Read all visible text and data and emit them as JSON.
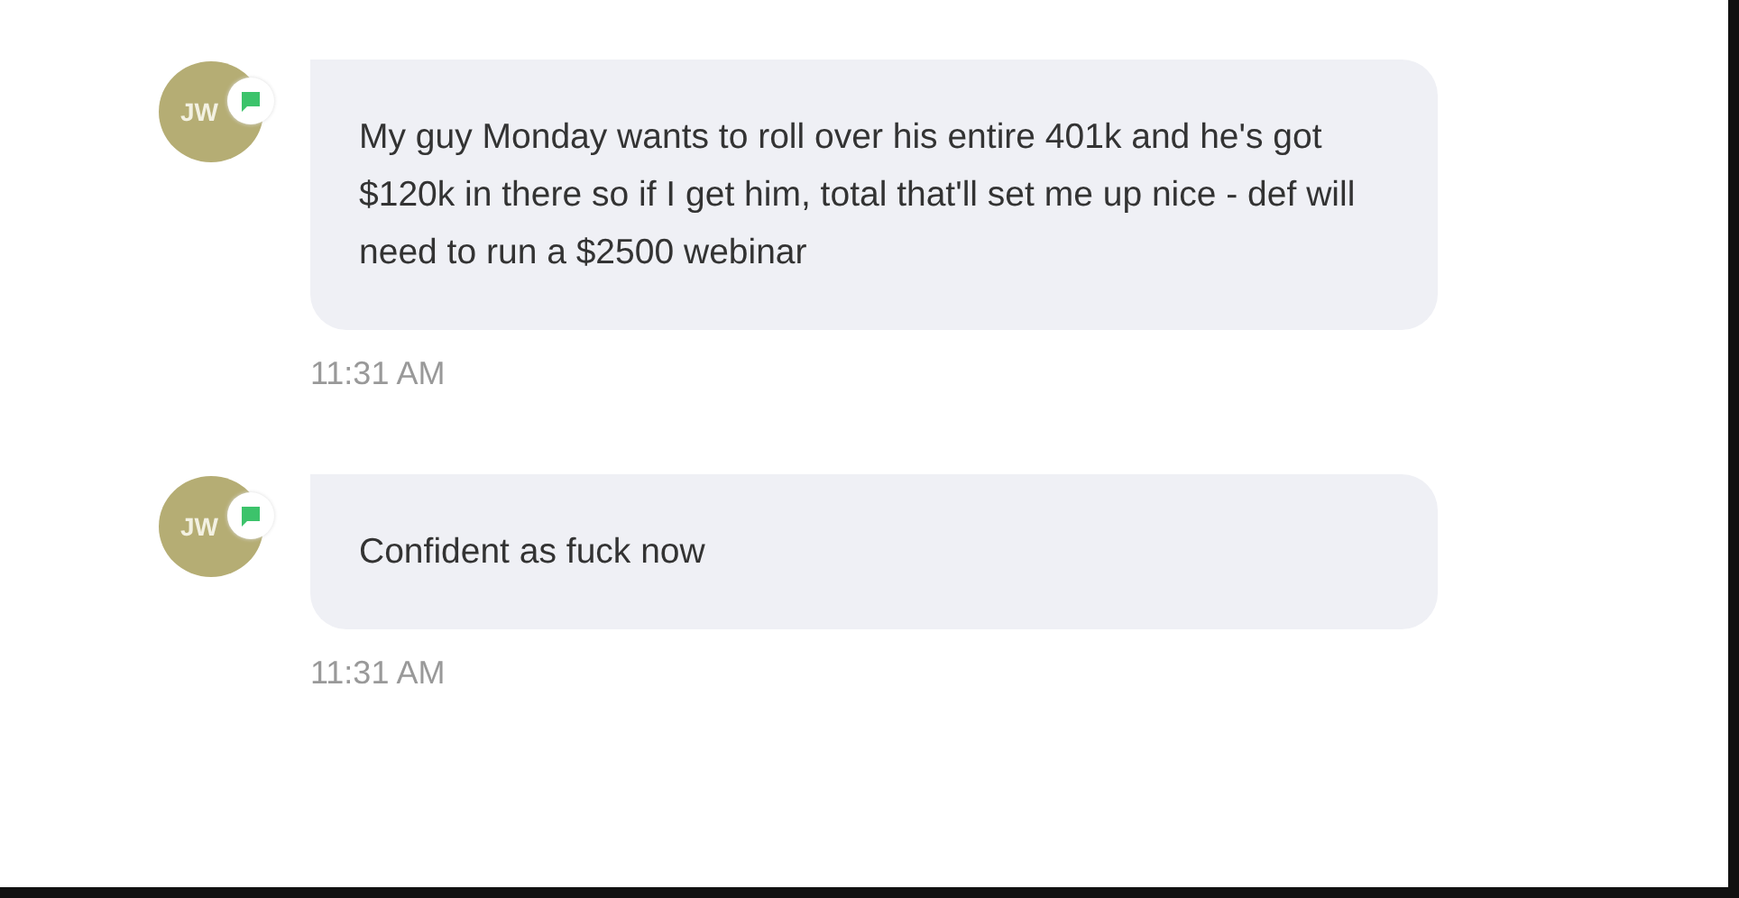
{
  "messages": [
    {
      "avatar": "JW",
      "text": "My guy Monday wants to roll over his entire 401k and he's got $120k in there so if I get him, total that'll set me up nice - def will need to run a $2500 webinar",
      "time": "11:31 AM"
    },
    {
      "avatar": "JW",
      "text": "Confident as fuck now",
      "time": "11:31 AM"
    }
  ]
}
